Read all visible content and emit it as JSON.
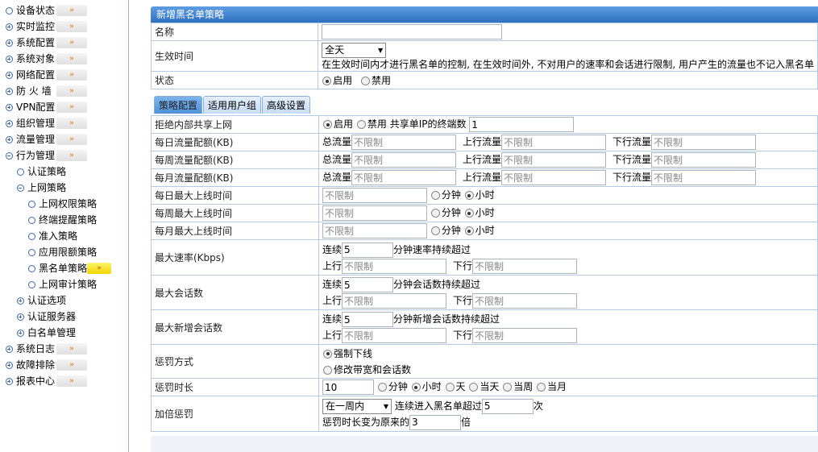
{
  "sidebar": {
    "items": [
      {
        "label": "设备状态",
        "icon": "circle-icon",
        "arrow": true
      },
      {
        "label": "实时监控",
        "icon": "plus-circle-icon",
        "arrow": true
      },
      {
        "label": "系统配置",
        "icon": "plus-circle-icon",
        "arrow": true
      },
      {
        "label": "系统对象",
        "icon": "plus-circle-icon",
        "arrow": true
      },
      {
        "label": "网络配置",
        "icon": "plus-circle-icon",
        "arrow": true
      },
      {
        "label": "防 火 墙",
        "icon": "plus-circle-icon",
        "arrow": true
      },
      {
        "label": "VPN配置",
        "icon": "plus-circle-icon",
        "arrow": true
      },
      {
        "label": "组织管理",
        "icon": "plus-circle-icon",
        "arrow": true
      },
      {
        "label": "流量管理",
        "icon": "plus-circle-icon",
        "arrow": true
      },
      {
        "label": "行为管理",
        "icon": "minus-circle-icon",
        "arrow": true
      },
      {
        "label": "认证策略",
        "icon": "circle-icon",
        "arrow": false
      },
      {
        "label": "上网策略",
        "icon": "minus-circle-icon",
        "arrow": false
      },
      {
        "label": "上网权限策略",
        "icon": "circle-icon",
        "arrow": false
      },
      {
        "label": "终端提醒策略",
        "icon": "circle-icon",
        "arrow": false
      },
      {
        "label": "准入策略",
        "icon": "circle-icon",
        "arrow": false
      },
      {
        "label": "应用限额策略",
        "icon": "circle-icon",
        "arrow": false
      },
      {
        "label": "黑名单策略",
        "icon": "circle-icon",
        "arrow": true
      },
      {
        "label": "上网审计策略",
        "icon": "circle-icon",
        "arrow": false
      },
      {
        "label": "认证选项",
        "icon": "plus-circle-icon",
        "arrow": false
      },
      {
        "label": "认证服务器",
        "icon": "plus-circle-icon",
        "arrow": false
      },
      {
        "label": "白名单管理",
        "icon": "plus-circle-icon",
        "arrow": false
      },
      {
        "label": "系统日志",
        "icon": "plus-circle-icon",
        "arrow": true
      },
      {
        "label": "故障排除",
        "icon": "plus-circle-icon",
        "arrow": true
      },
      {
        "label": "报表中心",
        "icon": "plus-circle-icon",
        "arrow": true
      }
    ],
    "arrow_glyph": "»"
  },
  "form": {
    "title": "新增黑名单策略",
    "name_label": "名称",
    "name_value": "",
    "time_label": "生效时间",
    "time_value": "全天",
    "time_note": "在生效时间内才进行黑名单的控制, 在生效时间外, 不对用户的速率和会话进行限制, 用户产生的流量也不记入黑名单",
    "status_label": "状态",
    "enable": "启用",
    "disable": "禁用"
  },
  "tabs": [
    "策略配置",
    "适用用户组",
    "高级设置"
  ],
  "policy": {
    "share_label": "拒绝内部共享上网",
    "share_enable": "启用",
    "share_disable": "禁用",
    "share_count_label": "共享单IP的终端数",
    "share_count_value": "1",
    "total_label": "总流量",
    "up_label": "上行流量",
    "down_label": "下行流量",
    "unlimited": "不限制",
    "daily_flow": "每日流量配额(KB)",
    "weekly_flow": "每周流量配额(KB)",
    "monthly_flow": "每月流量配额(KB)",
    "daily_online": "每日最大上线时间",
    "weekly_online": "每周最大上线时间",
    "monthly_online": "每月最大上线时间",
    "minute": "分钟",
    "hour": "小时",
    "max_rate_label": "最大速率(Kbps)",
    "continuous": "连续",
    "rate_value": "5",
    "rate_suffix": "分钟速率持续超过",
    "up": "上行",
    "down": "下行",
    "max_session_label": "最大会话数",
    "session_value": "5",
    "session_suffix": "分钟会话数持续超过",
    "max_new_session_label": "最大新增会话数",
    "new_session_value": "5",
    "new_session_suffix": "分钟新增会话数持续超过",
    "punish_label": "惩罚方式",
    "punish_opt1": "强制下线",
    "punish_opt2": "修改带宽和会话数",
    "punish_time_label": "惩罚时长",
    "punish_time_value": "10",
    "day": "天",
    "today": "当天",
    "this_week": "当周",
    "this_month": "当月",
    "double_label": "加倍惩罚",
    "double_period": "在一周内",
    "double_mid": "连续进入黑名单超过",
    "double_count": "5",
    "double_unit": "次",
    "double_factor_label": "惩罚时长变为原来的",
    "double_factor": "3",
    "double_factor_unit": "倍"
  }
}
